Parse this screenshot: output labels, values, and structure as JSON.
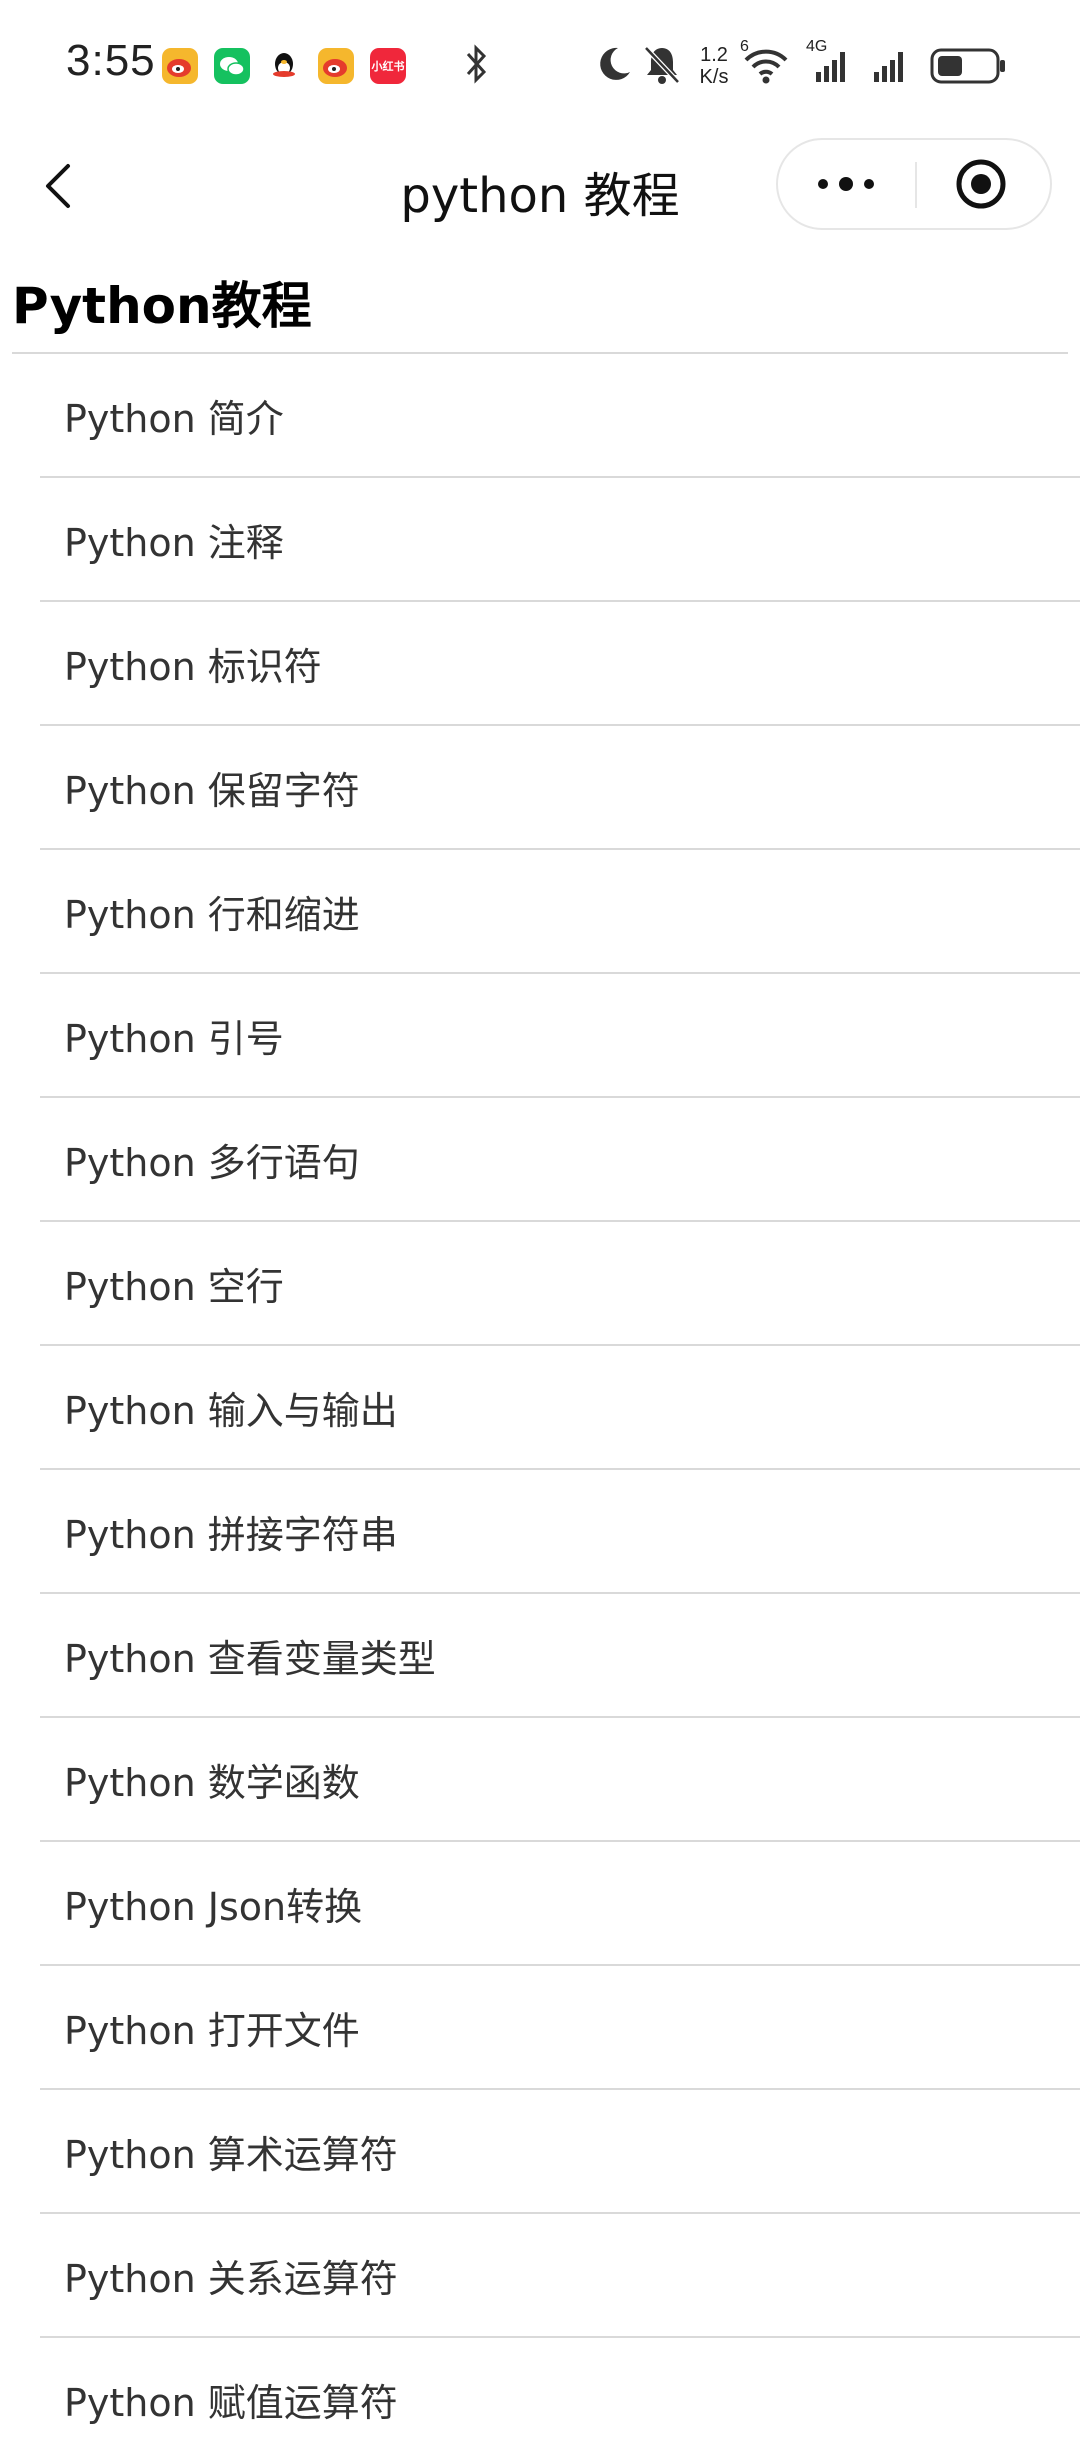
{
  "status_bar": {
    "time": "3:55",
    "apps": [
      {
        "icon": "weibo-icon",
        "color": "#f5b72d",
        "glyph": "◉"
      },
      {
        "icon": "wechat-icon",
        "color": "#15c15f",
        "glyph": "✉"
      },
      {
        "icon": "qq-icon",
        "color": "#ffffff",
        "glyph": "🐧"
      },
      {
        "icon": "weibo-icon",
        "color": "#f5b72d",
        "glyph": "◉"
      },
      {
        "icon": "xiaohongshu-icon",
        "color": "#f0273b",
        "label": "小红书"
      }
    ],
    "net_speed_value": "1.2",
    "net_speed_unit": "K/s",
    "wifi_badge": "6",
    "cell_badge": "4G",
    "battery_level": 0.45
  },
  "nav": {
    "title": "python 教程"
  },
  "section": {
    "title": "Python教程"
  },
  "items": [
    {
      "label": "Python 简介"
    },
    {
      "label": "Python 注释"
    },
    {
      "label": "Python 标识符"
    },
    {
      "label": "Python 保留字符"
    },
    {
      "label": "Python 行和缩进"
    },
    {
      "label": "Python 引号"
    },
    {
      "label": "Python 多行语句"
    },
    {
      "label": "Python 空行"
    },
    {
      "label": "Python 输入与输出"
    },
    {
      "label": "Python 拼接字符串"
    },
    {
      "label": "Python 查看变量类型"
    },
    {
      "label": "Python 数学函数"
    },
    {
      "label": "Python Json转换"
    },
    {
      "label": "Python 打开文件"
    },
    {
      "label": "Python 算术运算符"
    },
    {
      "label": "Python 关系运算符"
    },
    {
      "label": "Python 赋值运算符"
    }
  ]
}
